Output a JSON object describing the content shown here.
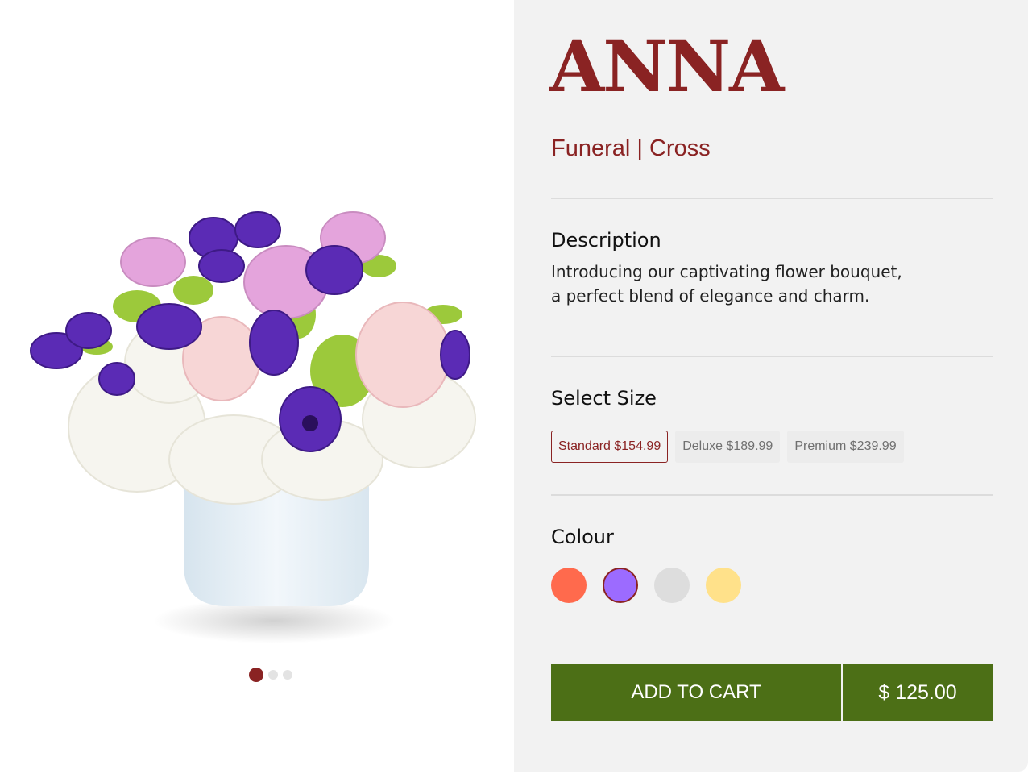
{
  "product": {
    "name": "ANNA",
    "category": "Funeral | Cross",
    "image_alt": "Flower arrangement in a white vase"
  },
  "gallery": {
    "slide_count": 3,
    "active_slide": 1
  },
  "description": {
    "heading": "Description",
    "text": "Introducing our captivating flower bouquet, a perfect blend of elegance and charm."
  },
  "size": {
    "heading": "Select Size",
    "options": [
      {
        "label": "Standard $154.99",
        "selected": true
      },
      {
        "label": "Deluxe $189.99",
        "selected": false
      },
      {
        "label": "Premium $239.99",
        "selected": false
      }
    ]
  },
  "colour": {
    "heading": "Colour",
    "swatches": [
      {
        "name": "coral",
        "hex": "#ff6a4d",
        "selected": false
      },
      {
        "name": "purple",
        "hex": "#9c6bff",
        "selected": true
      },
      {
        "name": "light-grey",
        "hex": "#dddddd",
        "selected": false
      },
      {
        "name": "pale-yellow",
        "hex": "#ffe18a",
        "selected": false
      }
    ]
  },
  "cart": {
    "button_label": "ADD TO CART",
    "price": "$ 125.00"
  },
  "theme": {
    "brand": "#8a2323",
    "cart_green": "#4c6f16"
  }
}
